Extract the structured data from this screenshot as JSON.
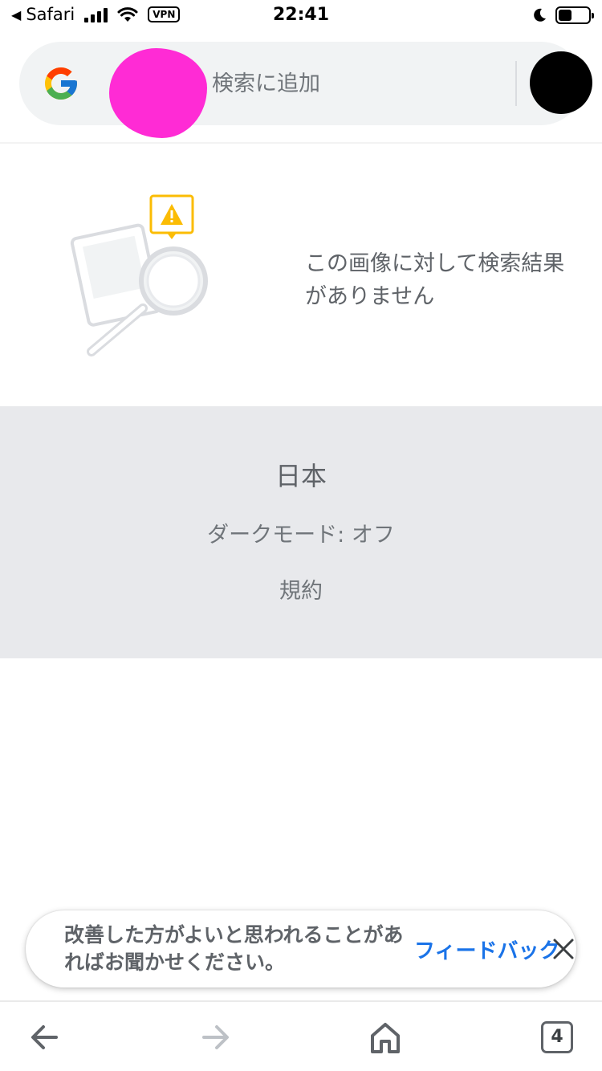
{
  "status_bar": {
    "back_app": "Safari",
    "time": "22:41",
    "vpn": "VPN",
    "battery_level": 0.45
  },
  "search": {
    "placeholder": "検索に追加",
    "logo": "google-g-logo"
  },
  "no_result": {
    "message": "この画像に対して検索結果がありません",
    "illustration": "photo-magnifier-warning"
  },
  "footer": {
    "country": "日本",
    "dark_mode": "ダークモード: オフ",
    "terms": "規約"
  },
  "feedback": {
    "message": "改善した方がよいと思われることがあればお聞かせください。",
    "link": "フィードバック"
  },
  "toolbar": {
    "tab_count": "4",
    "icons": [
      "back-arrow-icon",
      "forward-arrow-icon",
      "home-icon",
      "tabs-icon"
    ]
  },
  "colors": {
    "accent_link": "#1a73e8",
    "warning": "#fbbc04",
    "highlight_mask": "#ff2bd5"
  }
}
